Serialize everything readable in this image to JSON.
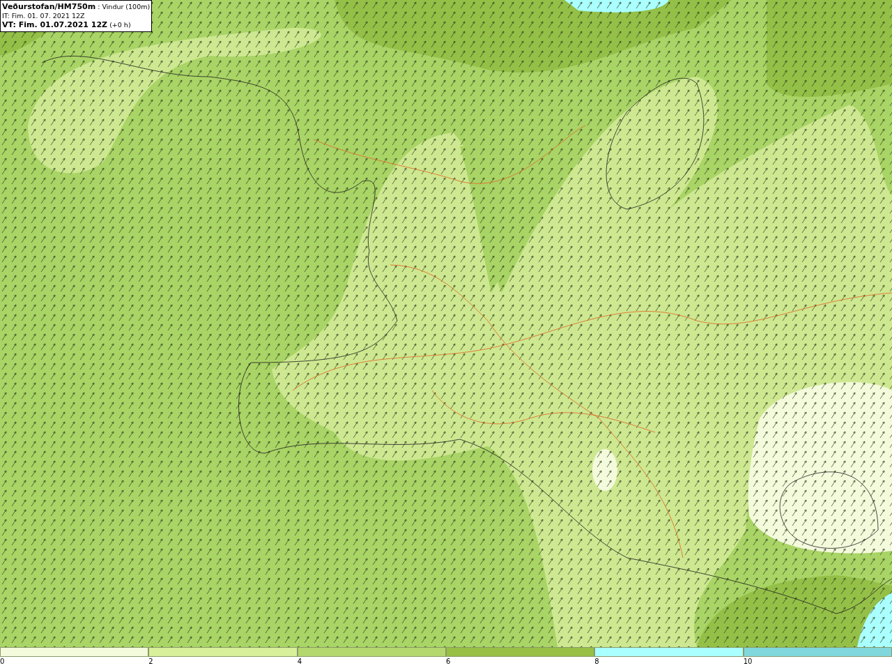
{
  "header": {
    "lines": [
      "**Veðurstofan/HM750m** : Vindur (100m)",
      "IT: Fim. 01. 07. 2021 12Z",
      "**VT: Fim. 01.07.2021 12Z** (+0 h)"
    ]
  },
  "legend": {
    "segments": [
      {
        "label": "0",
        "color": "#f4fadc"
      },
      {
        "label": "2",
        "color": "#d8f09a"
      },
      {
        "label": "4",
        "color": "#b5d86e"
      },
      {
        "label": "6",
        "color": "#97c044"
      },
      {
        "label": "8",
        "color": "#aaffff"
      },
      {
        "label": "10",
        "color": "#80d8dc"
      }
    ]
  }
}
